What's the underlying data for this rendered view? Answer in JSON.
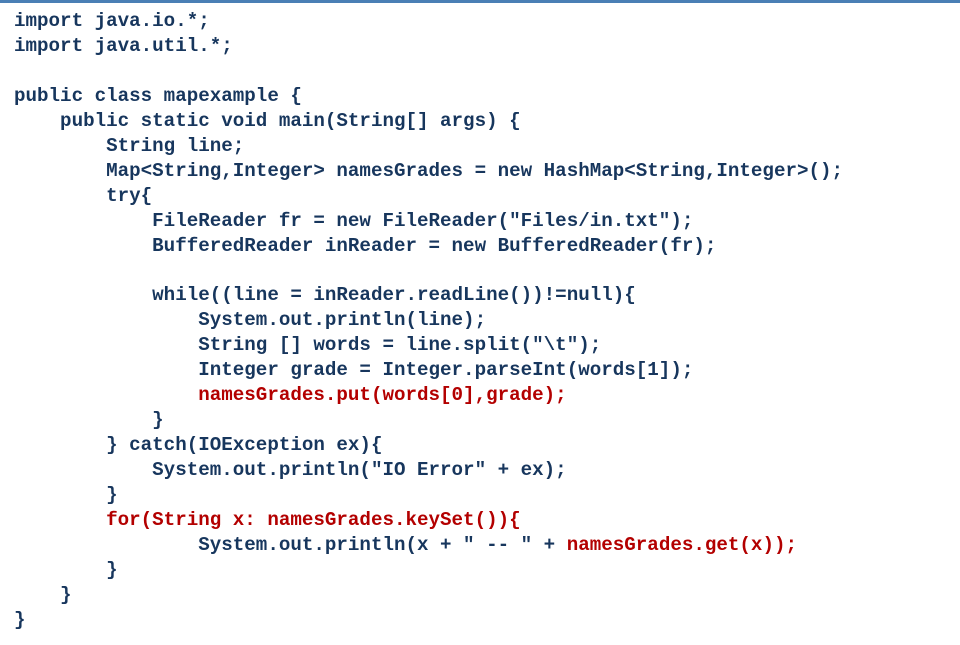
{
  "code": {
    "l01": "import java.io.*;",
    "l02": "import java.util.*;",
    "l03": "",
    "l04": "public class mapexample {",
    "l05": "    public static void main(String[] args) {",
    "l06": "        String line;",
    "l07": "        Map<String,Integer> namesGrades = new HashMap<String,Integer>();",
    "l08": "        try{",
    "l09": "            FileReader fr = new FileReader(\"Files/in.txt\");",
    "l10": "            BufferedReader inReader = new BufferedReader(fr);",
    "l11": "",
    "l12": "            while((line = inReader.readLine())!=null){",
    "l13": "                System.out.println(line);",
    "l14": "                String [] words = line.split(\"\\t\");",
    "l15": "                Integer grade = Integer.parseInt(words[1]);",
    "l16": "                namesGrades.put(words[0],grade);",
    "l17": "            }",
    "l18": "        } catch(IOException ex){",
    "l19": "            System.out.println(\"IO Error\" + ex);",
    "l20": "        }",
    "l21": "        for(String x: namesGrades.keySet()){",
    "l22a": "                System.out.println(x + \" -- \" + ",
    "l22b": "namesGrades.get(x));",
    "l23": "        }",
    "l24": "    }",
    "l25": "}"
  }
}
